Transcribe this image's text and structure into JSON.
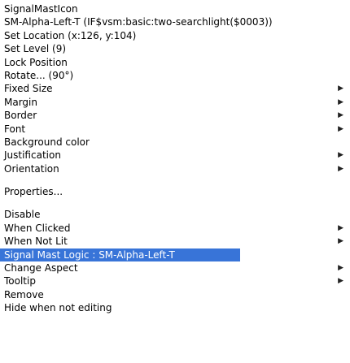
{
  "header": {
    "title": "SignalMastIcon",
    "subtitle": "SM-Alpha-Left-T (IF$vsm:basic:two-searchlight($0003))",
    "location": "Set Location (x:126, y:104)",
    "level": "Set Level (9)"
  },
  "items": {
    "lock_position": "Lock Position",
    "rotate": "Rotate... (90°)",
    "fixed_size": "Fixed Size",
    "margin": "Margin",
    "border": "Border",
    "font": "Font",
    "background_color": "Background color",
    "justification": "Justification",
    "orientation": "Orientation",
    "properties": "Properties...",
    "disable": "Disable",
    "when_clicked": "When Clicked",
    "when_not_lit": "When Not Lit",
    "signal_mast_logic": "Signal Mast Logic : SM-Alpha-Left-T",
    "change_aspect": "Change Aspect",
    "tooltip": "Tooltip",
    "remove": "Remove",
    "hide_when_not_editing": "Hide when not editing"
  },
  "icons": {
    "submenu_arrow": "▶"
  },
  "colors": {
    "highlight": "#3874d8",
    "highlight_text": "#ffffff"
  }
}
